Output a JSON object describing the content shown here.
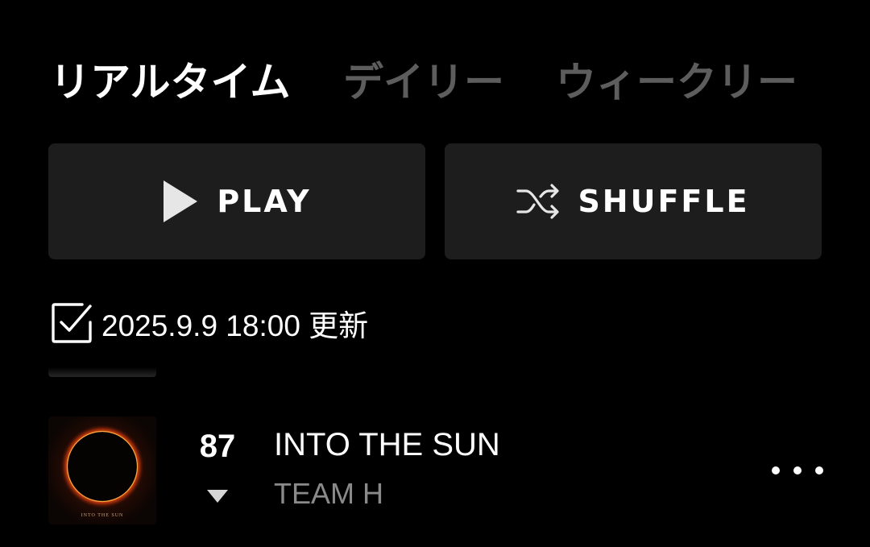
{
  "tabs": [
    {
      "label": "リアルタイム",
      "active": true
    },
    {
      "label": "デイリー",
      "active": false
    },
    {
      "label": "ウィークリー",
      "active": false
    }
  ],
  "actions": {
    "play_label": "PLAY",
    "play_icon": "play-icon",
    "shuffle_label": "SHUFFLE",
    "shuffle_icon": "shuffle-icon"
  },
  "updated": {
    "icon": "checkbox-icon",
    "text": "2025.9.9 18:00 更新"
  },
  "chart_list": [
    {
      "rank": "87",
      "trend": "down",
      "trend_icon": "triangle-down-icon",
      "title": "INTO THE SUN",
      "artist": "TEAM H",
      "cover_caption": "INTO THE SUN",
      "more_icon": "more-horizontal-icon"
    }
  ],
  "colors": {
    "background": "#000000",
    "button_bg": "#1d1d1d",
    "tab_active": "#ffffff",
    "tab_inactive": "#5d5d5d",
    "secondary_text": "#8a8a8a",
    "accent_orange": "#e8561a"
  }
}
